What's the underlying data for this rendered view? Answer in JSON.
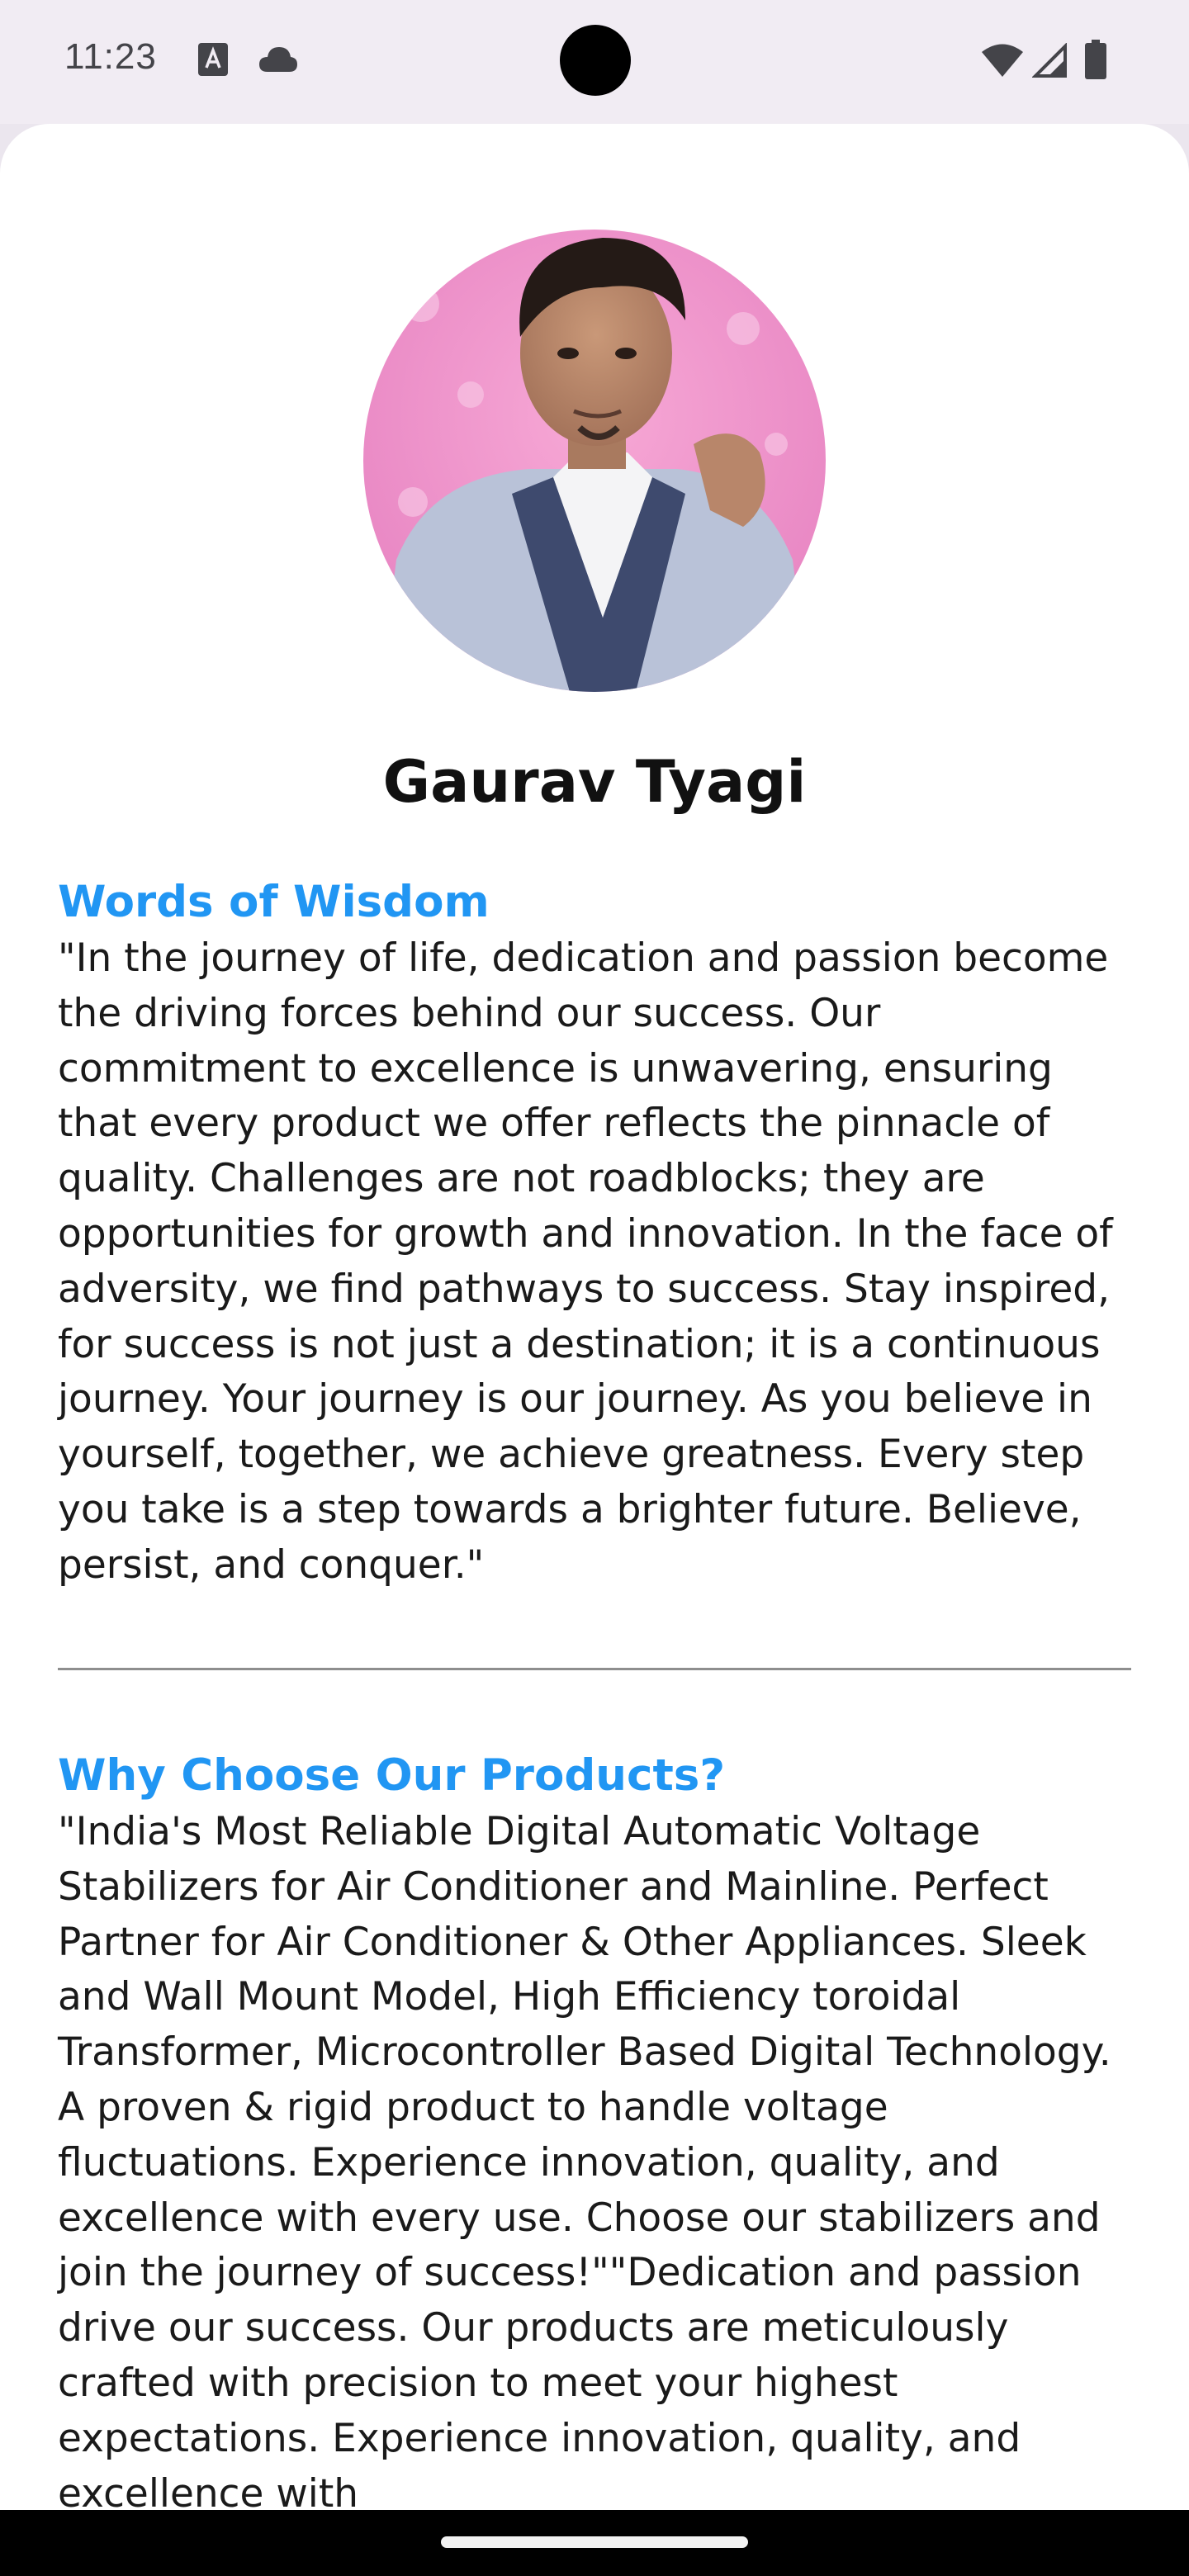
{
  "status_bar": {
    "time": "11:23",
    "left_icons": [
      "text-format-notification-icon",
      "cloud-notification-icon"
    ],
    "right_icons": [
      "wifi-icon",
      "cell-signal-icon",
      "battery-icon"
    ]
  },
  "profile": {
    "avatar": "profile-photo",
    "name": "Gaurav Tyagi"
  },
  "wisdom": {
    "title": "Words of Wisdom",
    "body": "\"In the journey of life, dedication and passion become the driving forces behind our success. Our commitment to excellence is unwavering, ensuring that every product we offer reflects the pinnacle of quality. Challenges are not roadblocks; they are opportunities for growth and innovation. In the face of adversity, we find pathways to success. Stay inspired, for success is not just a destination; it is a continuous journey. Your journey is our journey. As you believe in yourself, together, we achieve greatness. Every step you take is a step towards a brighter future. Believe, persist, and conquer.\""
  },
  "products": {
    "title": "Why Choose Our Products?",
    "body": "\"India's Most Reliable Digital Automatic Voltage Stabilizers for Air Conditioner and Mainline. Perfect Partner for Air Conditioner & Other Appliances. Sleek and Wall Mount Model, High Efficiency toroidal Transformer, Microcontroller Based Digital Technology. A proven & rigid product to handle voltage fluctuations. Experience innovation, quality, and excellence with every use. Choose our stabilizers and join the journey of success!\"\"Dedication and passion drive our success. Our products are meticulously crafted with precision to meet your highest expectations. Experience innovation, quality, and excellence with"
  },
  "colors": {
    "accent": "#2196f3",
    "status_bar_bg": "#f1ecf3",
    "sheet_bg": "#ffffff",
    "divider": "#8e8e8e"
  }
}
